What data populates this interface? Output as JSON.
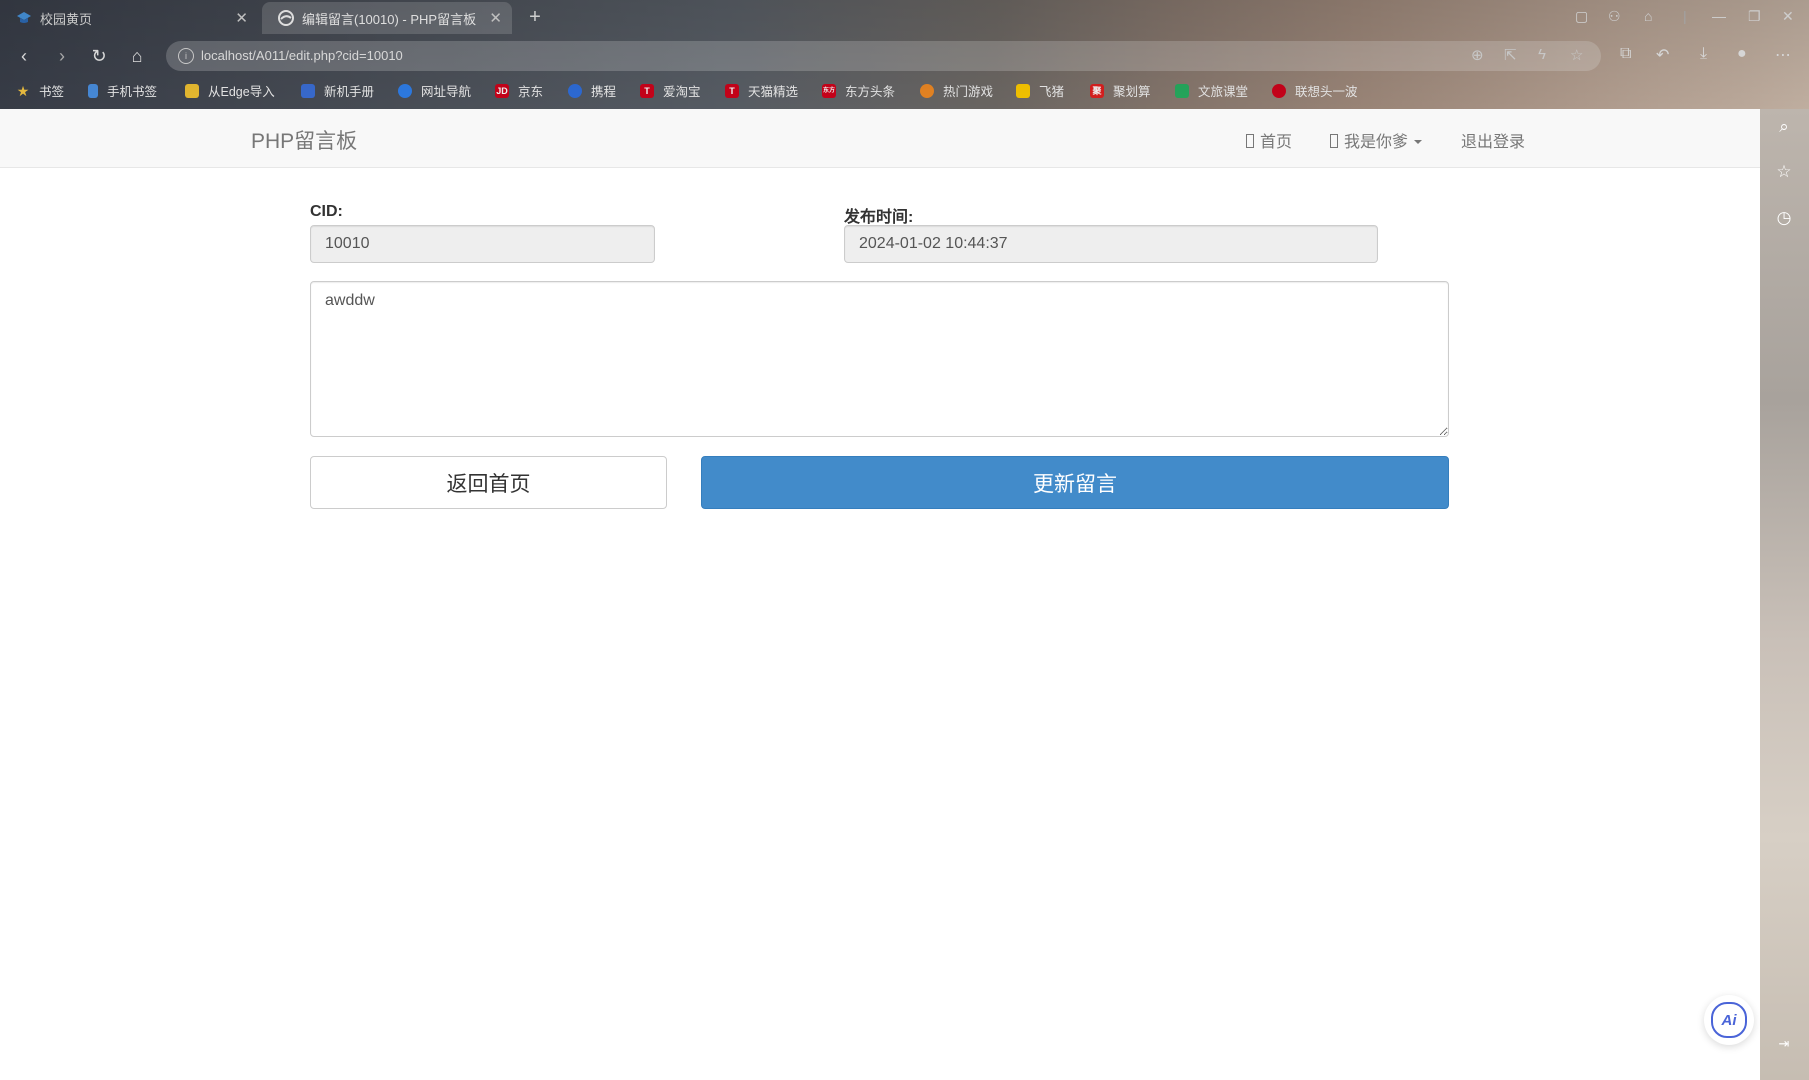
{
  "browser": {
    "tabs": [
      {
        "title": "校园黄页",
        "icon": "graduation-cap-icon"
      },
      {
        "title": "编辑留言(10010) - PHP留言板",
        "icon": "edge-logo-icon"
      }
    ],
    "url": "localhost/A011/edit.php?cid=10010",
    "bookmarks": [
      {
        "label": "书签",
        "color": "#f5c542"
      },
      {
        "label": "手机书签",
        "color": "#4a90e2"
      },
      {
        "label": "从Edge导入",
        "color": "#f1c232"
      },
      {
        "label": "新机手册",
        "color": "#3b6fd8"
      },
      {
        "label": "网址导航",
        "color": "#2f80ed"
      },
      {
        "label": "京东",
        "color": "#d0021b",
        "badge": "JD"
      },
      {
        "label": "携程",
        "color": "#2f6fde"
      },
      {
        "label": "爱淘宝",
        "color": "#d0021b",
        "badge": "T"
      },
      {
        "label": "天猫精选",
        "color": "#d0021b",
        "badge": "T"
      },
      {
        "label": "东方头条",
        "color": "#d0021b",
        "badge": "东方"
      },
      {
        "label": "热门游戏",
        "color": "#f08a24"
      },
      {
        "label": "飞猪",
        "color": "#ffcc00"
      },
      {
        "label": "聚划算",
        "color": "#e02020",
        "badge": "聚"
      },
      {
        "label": "文旅课堂",
        "color": "#27ae60"
      },
      {
        "label": "联想头一波",
        "color": "#d0021b"
      }
    ]
  },
  "navbar": {
    "brand": "PHP留言板",
    "links": [
      {
        "label": "首页"
      },
      {
        "label": "我是你爹"
      },
      {
        "label": "退出登录"
      }
    ]
  },
  "form": {
    "cid_label": "CID:",
    "cid_value": "10010",
    "time_label": "发布时间:",
    "time_value": "2024-01-02 10:44:37",
    "content_value": "awddw",
    "back_label": "返回首页",
    "update_label": "更新留言"
  },
  "colors": {
    "primary": "#428bca",
    "navbar_bg": "#f8f8f8"
  }
}
